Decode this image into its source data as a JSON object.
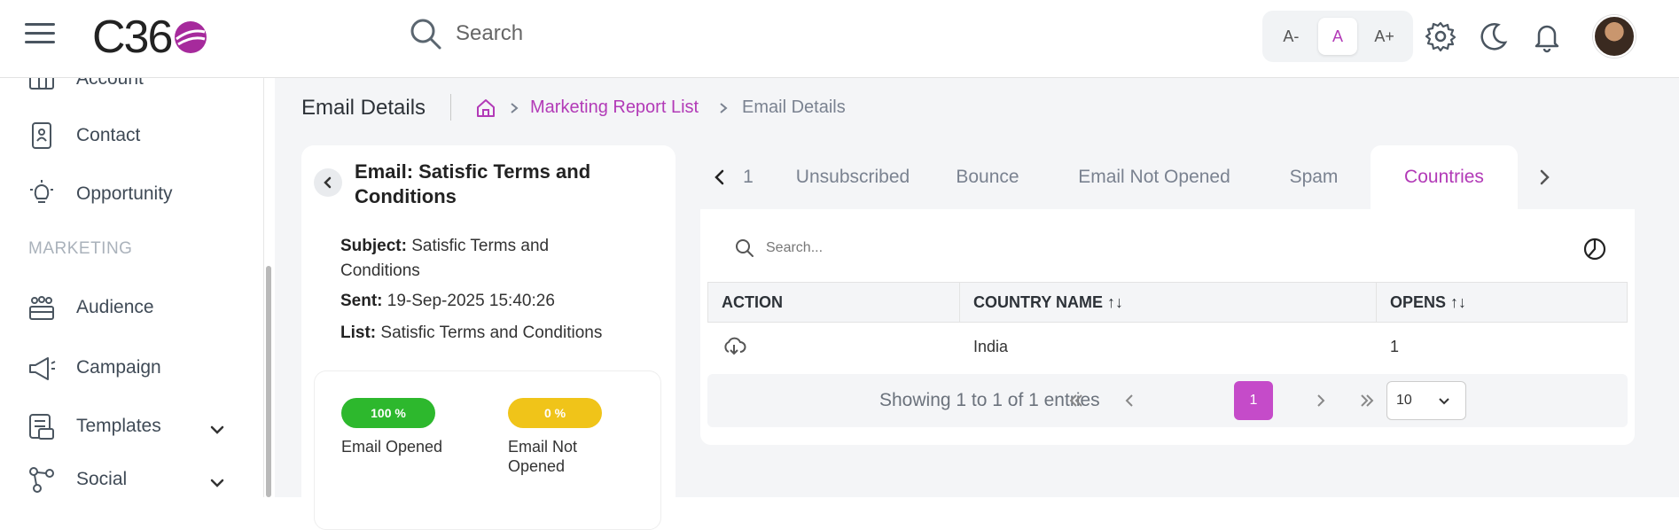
{
  "header": {
    "logo_text": "C36",
    "search_label": "Search",
    "font_small": "A-",
    "font_normal": "A",
    "font_large": "A+"
  },
  "sidebar": {
    "items": [
      {
        "label": "Account",
        "icon": "account-icon"
      },
      {
        "label": "Contact",
        "icon": "contact-icon"
      },
      {
        "label": "Opportunity",
        "icon": "lightbulb-icon"
      },
      {
        "label": "Audience",
        "icon": "audience-icon"
      },
      {
        "label": "Campaign",
        "icon": "megaphone-icon"
      },
      {
        "label": "Templates",
        "icon": "templates-icon"
      },
      {
        "label": "Social",
        "icon": "share-icon"
      }
    ],
    "section_marketing": "MARKETING"
  },
  "breadcrumb": {
    "page_title": "Email Details",
    "link": "Marketing Report List",
    "current": "Email Details"
  },
  "email": {
    "title": "Email: Satisfic Terms and Conditions",
    "subject_label": "Subject:",
    "subject": "Satisfic Terms and Conditions",
    "sent_label": "Sent:",
    "sent": "19-Sep-2025 15:40:26",
    "list_label": "List:",
    "list": "Satisfic Terms and Conditions",
    "opened_pct": "100 %",
    "opened_label": "Email Opened",
    "not_opened_pct": "0 %",
    "not_opened_label": "Email Not Opened"
  },
  "tabs": {
    "partial": "1",
    "items": [
      "Unsubscribed",
      "Bounce",
      "Email Not Opened",
      "Spam",
      "Countries"
    ],
    "active": "Countries"
  },
  "table": {
    "search_placeholder": "Search...",
    "headers": {
      "action": "ACTION",
      "country": "COUNTRY NAME ↑↓",
      "opens": "OPENS ↑↓"
    },
    "rows": [
      {
        "country": "India",
        "opens": "1"
      }
    ],
    "showing": "Showing 1 to 1 of 1 entries",
    "current_page": "1",
    "page_size": "10"
  },
  "colors": {
    "accent": "#b23ab7",
    "opened": "#2db82d",
    "not_opened": "#f0c419"
  }
}
